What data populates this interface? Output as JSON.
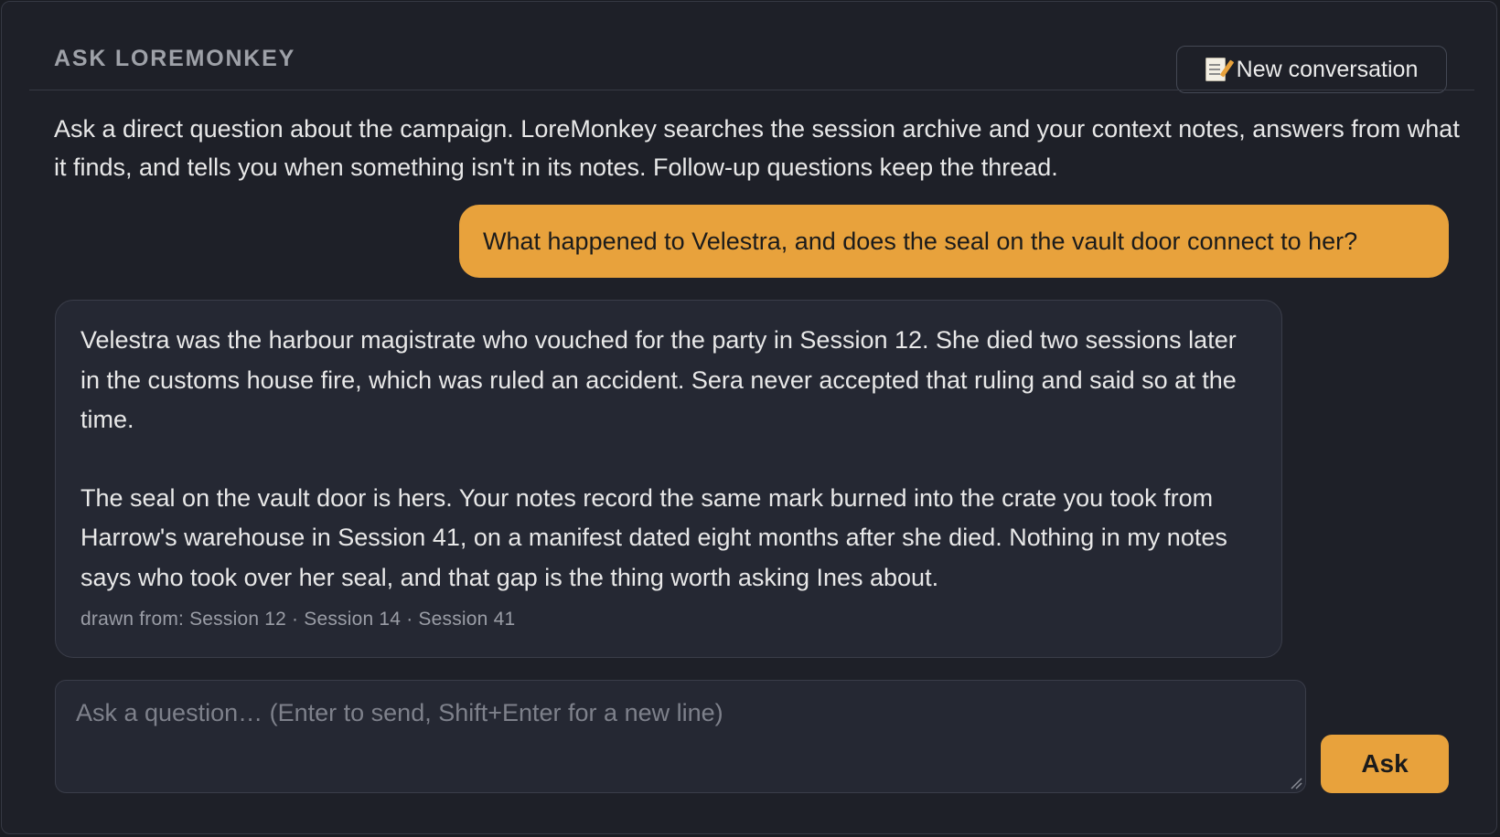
{
  "header": {
    "title": "ASK LOREMONKEY",
    "new_conversation_label": "New conversation",
    "new_conversation_icon": "memo-icon"
  },
  "intro": "Ask a direct question about the campaign. LoreMonkey searches the session archive and your context notes, answers from what it finds, and tells you when something isn't in its notes. Follow-up questions keep the thread.",
  "conversation": {
    "user_message": "What happened to Velestra, and does the seal on the vault door connect to her?",
    "assistant_reply": {
      "paragraphs": [
        "Velestra was the harbour magistrate who vouched for the party in Session 12. She died two sessions later in the customs house fire, which was ruled an accident. Sera never accepted that ruling and said so at the time.",
        "The seal on the vault door is hers. Your notes record the same mark burned into the crate you took from Harrow's warehouse in Session 41, on a manifest dated eight months after she died. Nothing in my notes says who took over her seal, and that gap is the thing worth asking Ines about."
      ],
      "sources": "drawn from: Session 12 · Session 14 · Session 41"
    }
  },
  "composer": {
    "value": "",
    "placeholder": "Ask a question… (Enter to send, Shift+Enter for a new line)",
    "ask_label": "Ask"
  },
  "colors": {
    "accent": "#e8a23c",
    "background": "#1e2028",
    "bubble": "#252833"
  }
}
